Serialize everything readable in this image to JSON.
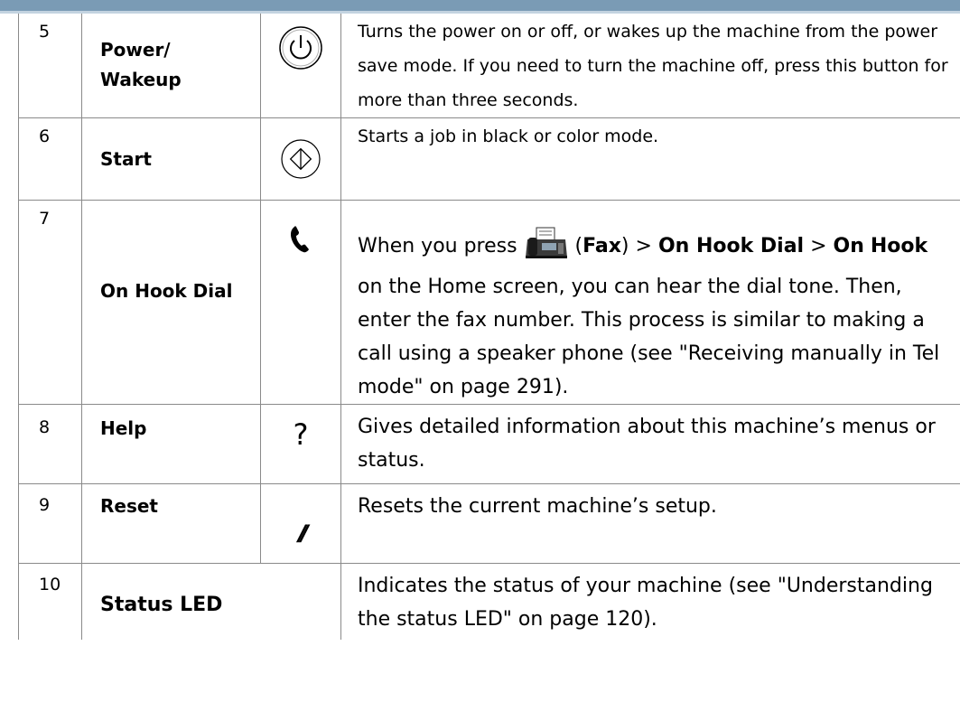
{
  "rows": [
    {
      "num": "5",
      "name": "Power/\nWakeup",
      "icon": "power-icon",
      "desc": "Turns the power on or off, or wakes up the machine from the power save mode. If you need to turn the machine off, press this button for more than three seconds."
    },
    {
      "num": "6",
      "name": "Start",
      "icon": "start-icon",
      "desc": "Starts a job in black or color mode."
    },
    {
      "num": "7",
      "name": "On Hook Dial",
      "icon": "phone-handset-icon",
      "desc_parts": {
        "p1": "When you press ",
        "p2": " (",
        "fax": "Fax",
        "p3": ") > ",
        "ohd": "On Hook Dial",
        "p4": " > ",
        "on": "On",
        "hook": "Hook",
        "p5": " on the Home screen, you can hear the dial tone. Then, enter the fax number. This process is similar to making a call using a speaker phone (see \"Receiving manually in Tel mode\" on page 291)."
      }
    },
    {
      "num": "8",
      "name": "Help",
      "icon_text": "?",
      "desc": "Gives detailed information about this machine’s menus or status."
    },
    {
      "num": "9",
      "name": "Reset",
      "icon_text": "//",
      "desc": "Resets the current machine’s setup."
    },
    {
      "num": "10",
      "name": "Status LED",
      "desc": "Indicates the status of your machine (see \"Understanding the status LED\" on page 120)."
    }
  ],
  "colors": {
    "header_bar": "#7a9bb5",
    "header_line": "#c3d3e0",
    "border": "#8a8a8a"
  }
}
